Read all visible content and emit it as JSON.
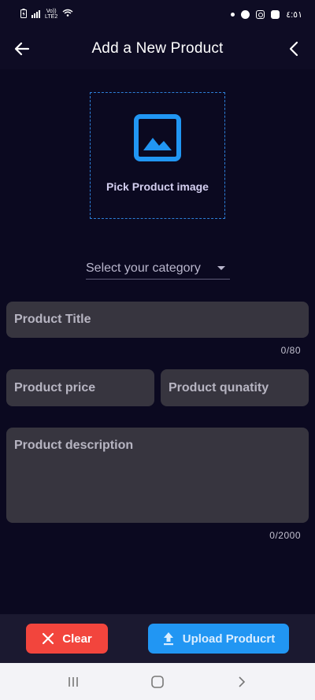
{
  "status_bar": {
    "network_label": "Vo))",
    "network_sub": "LTE2",
    "time": "٤:٥١"
  },
  "app_bar": {
    "title": "Add a New Product"
  },
  "image_picker": {
    "label": "Pick Product image"
  },
  "category": {
    "placeholder": "Select your category"
  },
  "form": {
    "title_placeholder": "Product Title",
    "title_counter": "0/80",
    "price_placeholder": "Product price",
    "quantity_placeholder": "Product qunatity",
    "description_placeholder": "Product description",
    "description_counter": "0/2000"
  },
  "actions": {
    "clear_label": "Clear",
    "upload_label": "Upload Producrt"
  },
  "colors": {
    "background": "#0b0920",
    "accent_blue": "#2196f3",
    "danger_red": "#f2453d",
    "field_bg": "#37353f"
  },
  "icons": {
    "back": "arrow-left-icon",
    "chevron": "chevron-left-icon",
    "image": "image-icon",
    "clear": "close-icon",
    "upload": "upload-icon"
  }
}
